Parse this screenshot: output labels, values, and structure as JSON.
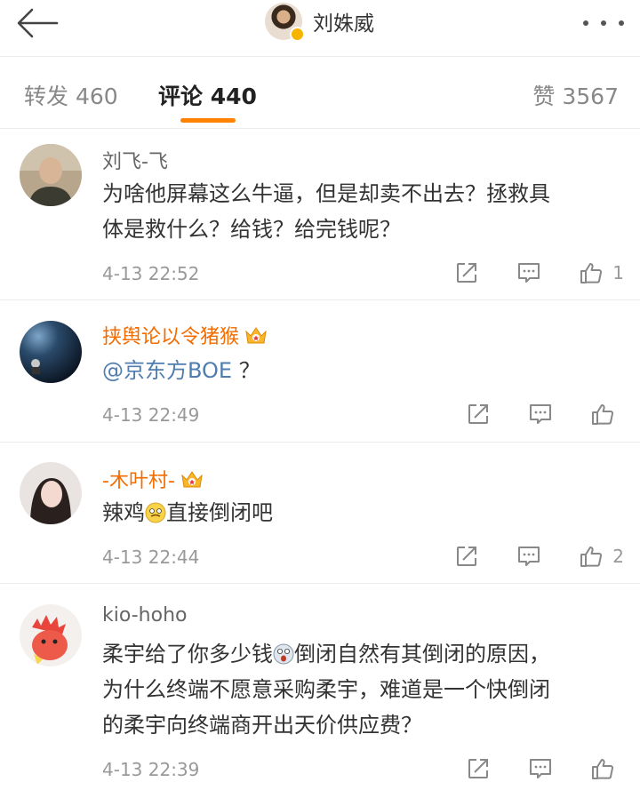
{
  "header": {
    "title": "刘姝威"
  },
  "tabs": {
    "forward": "转发 460",
    "comment": "评论 440",
    "like": "赞 3567"
  },
  "comments": [
    {
      "username": "刘飞-飞",
      "content_line1": "为啥他屏幕这么牛逼，但是却卖不出去？拯救具",
      "content_line2": "体是救什么？给钱？给完钱呢？",
      "time": "4-13 22:52",
      "likes": "1"
    },
    {
      "username": "挟舆论以令猪猴",
      "mention": "@京东方BOE",
      "content_tail": "？",
      "time": "4-13 22:49",
      "likes": ""
    },
    {
      "username": "-木叶村-",
      "content_a": "辣鸡",
      "content_b": "直接倒闭吧",
      "time": "4-13 22:44",
      "likes": "2"
    },
    {
      "username": "kio-hoho",
      "content_a": "柔宇给了你多少钱",
      "content_b": "倒闭自然有其倒闭的原因，",
      "content_line2": "为什么终端不愿意采购柔宇，难道是一个快倒闭",
      "content_line3": "的柔宇向终端商开出天价供应费？",
      "time": "4-13 22:39",
      "likes": ""
    }
  ],
  "colors": {
    "accent": "#ff8200",
    "vip_name": "#f36c00",
    "mention": "#507daf",
    "muted": "#999999"
  }
}
